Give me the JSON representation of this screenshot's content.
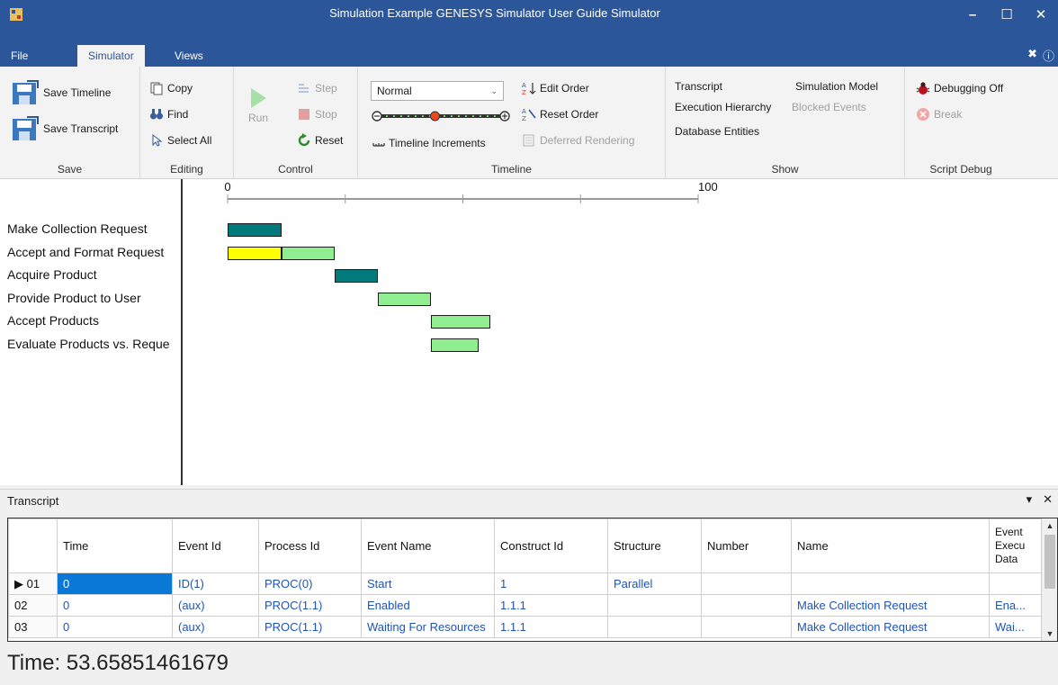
{
  "window": {
    "title": "Simulation Example GENESYS Simulator User Guide Simulator"
  },
  "tabs": [
    {
      "label": "File"
    },
    {
      "label": "Simulator"
    },
    {
      "label": "Views"
    }
  ],
  "ribbon": {
    "save": {
      "group_label": "Save",
      "save_timeline": "Save Timeline",
      "save_transcript": "Save Transcript"
    },
    "editing": {
      "group_label": "Editing",
      "copy": "Copy",
      "find": "Find",
      "select_all": "Select All"
    },
    "control": {
      "group_label": "Control",
      "run": "Run",
      "step": "Step",
      "stop": "Stop",
      "reset": "Reset"
    },
    "timeline": {
      "group_label": "Timeline",
      "mode_selected": "Normal",
      "increments": "Timeline Increments",
      "edit_order": "Edit Order",
      "reset_order": "Reset Order",
      "deferred_rendering": "Deferred Rendering",
      "slider_level": 0.45
    },
    "show": {
      "group_label": "Show",
      "transcript": "Transcript",
      "simulation_model": "Simulation Model",
      "execution_hierarchy": "Execution Hierarchy",
      "blocked_events": "Blocked Events",
      "database_entities": "Database Entities"
    },
    "script_debug": {
      "group_label": "Script Debug",
      "debugging": "Debugging Off",
      "break": "Break"
    }
  },
  "timeline_view": {
    "axis": {
      "min": 0,
      "max": 100,
      "ticks": [
        "0",
        "100"
      ]
    },
    "rows": [
      {
        "label": "Make Collection Request"
      },
      {
        "label": "Accept and Format Request"
      },
      {
        "label": "Acquire Product"
      },
      {
        "label": "Provide Product to User"
      },
      {
        "label": "Accept Products"
      },
      {
        "label": "Evaluate Products vs. Reque"
      }
    ],
    "bars": [
      {
        "row": 0,
        "start": 0,
        "end": 11.4,
        "color": "#007a7a"
      },
      {
        "row": 1,
        "start": 0,
        "end": 11.4,
        "color": "#ffff00"
      },
      {
        "row": 1,
        "start": 11.4,
        "end": 22.8,
        "color": "#90ee90"
      },
      {
        "row": 2,
        "start": 22.8,
        "end": 31.9,
        "color": "#007a7a"
      },
      {
        "row": 3,
        "start": 31.9,
        "end": 43.2,
        "color": "#90ee90"
      },
      {
        "row": 4,
        "start": 43.2,
        "end": 55.8,
        "color": "#90ee90"
      },
      {
        "row": 5,
        "start": 43.2,
        "end": 53.3,
        "color": "#90ee90"
      }
    ]
  },
  "transcript": {
    "title": "Transcript",
    "columns": [
      "",
      "Time",
      "Event Id",
      "Process Id",
      "Event Name",
      "Construct Id",
      "Structure",
      "Number",
      "Name",
      "Event Execu Data"
    ],
    "rows": [
      [
        "▶ 01",
        "0",
        "ID(1)",
        "PROC(0)",
        "Start",
        "1",
        "Parallel",
        "",
        "",
        ""
      ],
      [
        "02",
        "0",
        "(aux)",
        "PROC(1.1)",
        "Enabled",
        "1.1.1",
        "",
        "",
        "Make Collection Request",
        "Ena..."
      ],
      [
        "03",
        "0",
        "(aux)",
        "PROC(1.1)",
        "Waiting For Resources",
        "1.1.1",
        "",
        "",
        "Make Collection Request",
        "Wai..."
      ]
    ]
  },
  "status": {
    "time": "Time: 53.65851461679"
  },
  "colors": {
    "titlebar": "#2b579a",
    "selection": "#0a78d7",
    "teal": "#007a7a",
    "yellow": "#ffff00",
    "lightgreen": "#90ee90"
  }
}
